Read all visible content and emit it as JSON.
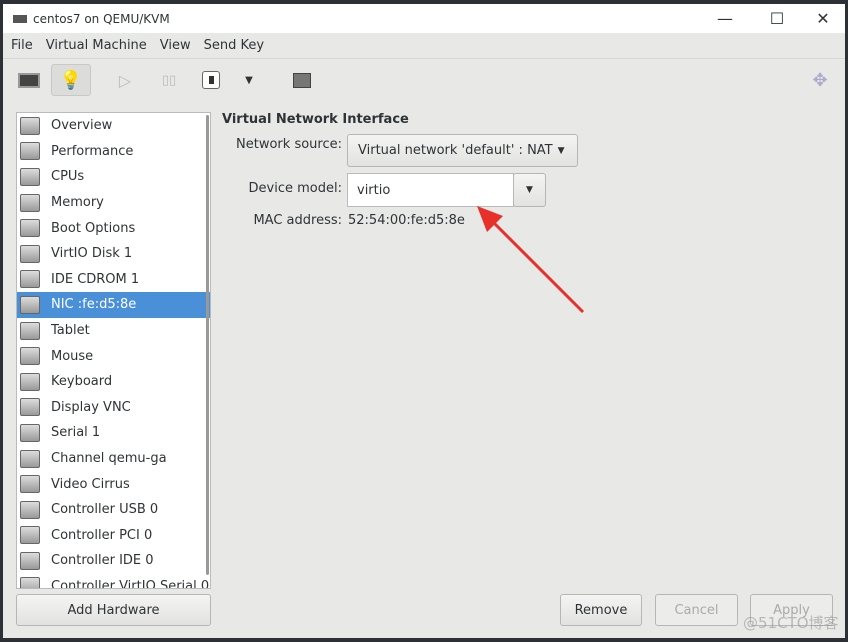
{
  "window": {
    "title": "centos7 on QEMU/KVM"
  },
  "menu": [
    "File",
    "Virtual Machine",
    "View",
    "Send Key"
  ],
  "sidebar": {
    "items": [
      "Overview",
      "Performance",
      "CPUs",
      "Memory",
      "Boot Options",
      "VirtIO Disk 1",
      "IDE CDROM 1",
      "NIC :fe:d5:8e",
      "Tablet",
      "Mouse",
      "Keyboard",
      "Display VNC",
      "Serial 1",
      "Channel qemu-ga",
      "Video Cirrus",
      "Controller USB 0",
      "Controller PCI 0",
      "Controller IDE 0",
      "Controller VirtIO Serial 0"
    ],
    "selected": "NIC :fe:d5:8e",
    "add_hardware": "Add Hardware"
  },
  "detail": {
    "heading": "Virtual Network Interface",
    "network_source_label": "Network source:",
    "network_source_value": "Virtual network 'default' : NAT",
    "device_model_label": "Device model:",
    "device_model_value": "virtio",
    "mac_label": "MAC address:",
    "mac_value": "52:54:00:fe:d5:8e"
  },
  "buttons": {
    "remove": "Remove",
    "cancel": "Cancel",
    "apply": "Apply"
  },
  "watermark": "@51CTO博客",
  "colors": {
    "selection": "#4a90d9",
    "arrow": "#e8302a"
  }
}
